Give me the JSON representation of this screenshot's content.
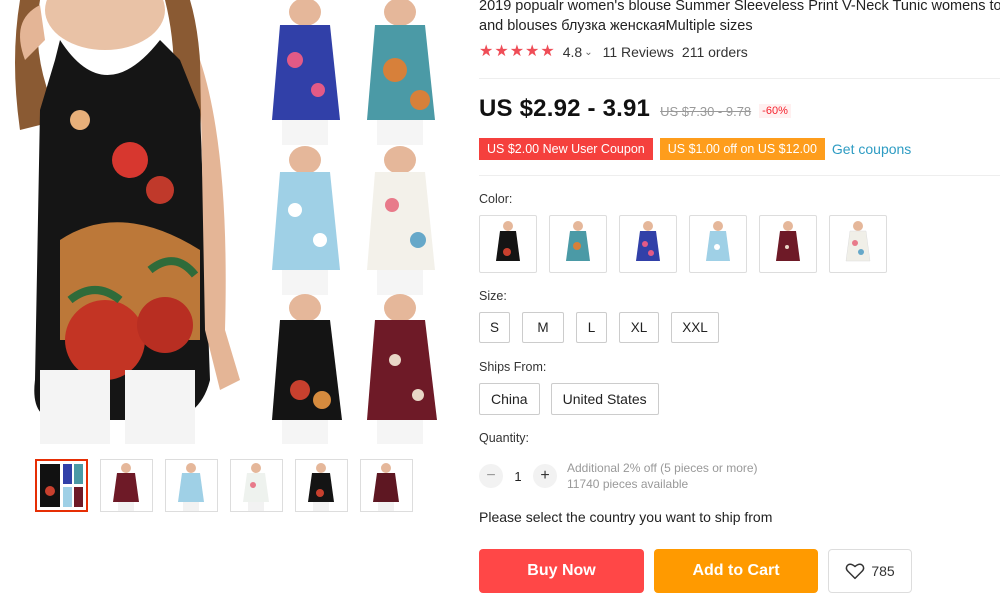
{
  "product": {
    "title_line1": "2019 popualr women's blouse Summer Sleeveless Print V-Neck Tunic womens to",
    "title_line2": "and blouses блузка женскаяMultiple sizes"
  },
  "rating": {
    "stars": 5,
    "value": "4.8",
    "reviews": "11 Reviews",
    "orders": "211 orders"
  },
  "price": {
    "current": "US $2.92 - 3.91",
    "original": "US $7.30 - 9.78",
    "discount": "-60%"
  },
  "coupons": {
    "new_user": "US $2.00 New User Coupon",
    "store": "US $1.00 off on US $12.00",
    "get_label": "Get coupons"
  },
  "color": {
    "label": "Color:",
    "options": [
      "black-floral",
      "teal-mandala",
      "blue-floral",
      "light-blue-floral",
      "burgundy-floral",
      "white-floral"
    ]
  },
  "size": {
    "label": "Size:",
    "options": [
      "S",
      "M",
      "L",
      "XL",
      "XXL"
    ]
  },
  "ships_from": {
    "label": "Ships From:",
    "options": [
      "China",
      "United States"
    ]
  },
  "quantity": {
    "label": "Quantity:",
    "minus": "−",
    "plus": "+",
    "value": "1",
    "note_line1": "Additional 2% off (5 pieces or more)",
    "note_line2": "11740 pieces available"
  },
  "ship_note": "Please select the country you want to ship from",
  "actions": {
    "buy_now": "Buy Now",
    "add_to_cart": "Add to Cart",
    "wishlist_count": "785"
  },
  "colors": {
    "accent_red": "#ff4747",
    "accent_orange": "#ff9a00",
    "star": "#ef4d57",
    "link": "#2e9cc3"
  }
}
